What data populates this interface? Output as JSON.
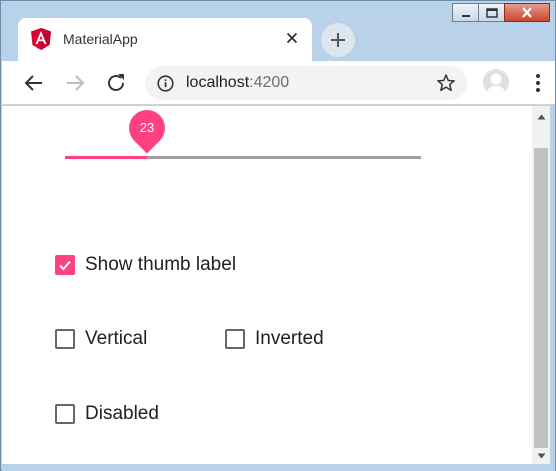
{
  "browser": {
    "tab_title": "MaterialApp",
    "url_host": "localhost",
    "url_port": ":4200"
  },
  "slider": {
    "value": 23,
    "value_label": "23",
    "fraction": 0.23,
    "accent_color": "#ff4081",
    "track_color": "#9e9e9e"
  },
  "options": {
    "show_thumb_label": {
      "label": "Show thumb label",
      "checked": true
    },
    "vertical": {
      "label": "Vertical",
      "checked": false
    },
    "inverted": {
      "label": "Inverted",
      "checked": false
    },
    "disabled": {
      "label": "Disabled",
      "checked": false
    }
  },
  "icons": {
    "app": "angular-logo-icon",
    "back": "back-arrow-icon",
    "forward": "forward-arrow-icon",
    "reload": "reload-icon",
    "info": "info-icon",
    "bookmark": "star-icon",
    "profile": "profile-avatar-icon",
    "menu": "kebab-menu-icon"
  }
}
